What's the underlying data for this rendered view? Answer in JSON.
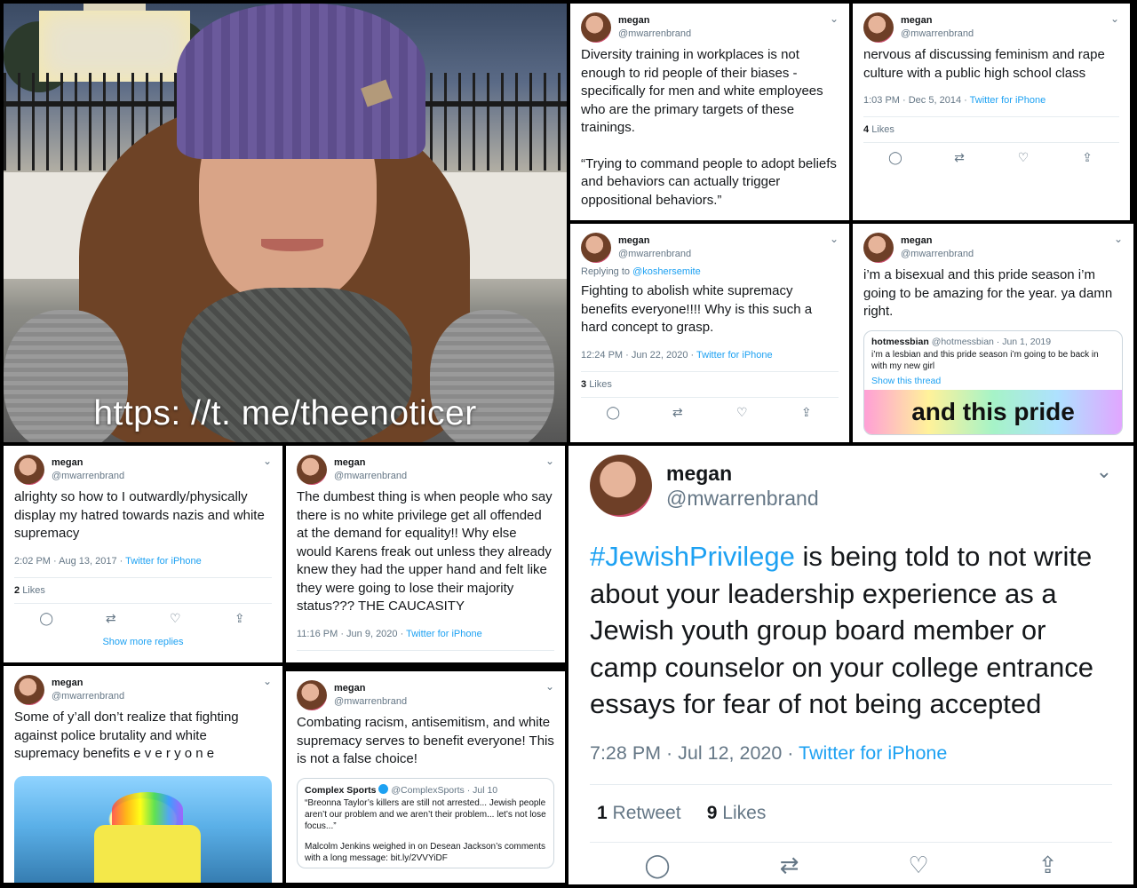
{
  "watermark": "https: //t. me/theenoticer",
  "user": {
    "name": "megan",
    "handle": "@mwarrenbrand"
  },
  "icons": {
    "chevron": "chevron-down-icon",
    "reply": "reply-icon",
    "retweet": "retweet-icon",
    "like": "heart-icon",
    "share": "share-icon"
  },
  "tweets": {
    "t1": {
      "text1": "Diversity training in workplaces is not enough to rid people of their biases - specifically for men and white employees who are the primary targets of these trainings.",
      "text2": "“Trying to command people to adopt beliefs and behaviors can actually trigger oppositional behaviors.”"
    },
    "t2": {
      "text": "nervous af discussing feminism and rape culture with a public high school class",
      "time": "1:03 PM · Dec 5, 2014",
      "source": "Twitter for iPhone",
      "likes_count": "4",
      "likes_label": "Likes"
    },
    "t3": {
      "replying_prefix": "Replying to",
      "replying_to": "@koshersemite",
      "text": "Fighting to abolish white supremacy benefits everyone!!!! Why is this such a hard concept to grasp.",
      "time": "12:24 PM · Jun 22, 2020",
      "source": "Twitter for iPhone",
      "likes_count": "3",
      "likes_label": "Likes"
    },
    "t4": {
      "text": "i’m a bisexual and this pride season i’m going to be amazing for the year. ya damn right.",
      "quote_name": "hotmessbian",
      "quote_meta": "@hotmessbian · Jun 1, 2019",
      "quote_text": "i’m a lesbian and this pride season i’m going to be back in with my new girl",
      "quote_link": "Show this thread",
      "quote_image_text": "and this pride"
    },
    "t5": {
      "text": "alrighty so how to I outwardly/physically display my hatred towards nazis and white supremacy",
      "time": "2:02 PM · Aug 13, 2017",
      "source": "Twitter for iPhone",
      "likes_count": "2",
      "likes_label": "Likes",
      "more_replies": "Show more replies"
    },
    "t6": {
      "text": "The dumbest thing is when people who say there is no white privilege get all offended at the demand for equality!! Why else would Karens freak out unless they already knew they had the upper hand and felt like they were going to lose their majority status??? THE CAUCASITY",
      "time": "11:16 PM · Jun 9, 2020",
      "source": "Twitter for iPhone"
    },
    "t7": {
      "text": "Some of y’all don’t realize that fighting against police brutality and white supremacy benefits e v e r y o n e"
    },
    "t8": {
      "text": "Combating racism, antisemitism, and white supremacy serves to benefit everyone! This is not a false choice!",
      "quote_name": "Complex Sports",
      "quote_meta": "@ComplexSports · Jul 10",
      "quote_text": "“Breonna Taylor’s killers are still not arrested... Jewish people aren’t our problem and we aren’t their problem... let’s not lose focus...”",
      "quote_text2": "Malcolm Jenkins weighed in on Desean Jackson’s comments with a long message: bit.ly/2VVYiDF"
    },
    "big": {
      "hashtag": "#JewishPrivilege",
      "text": " is being told to not write about your leadership experience as a Jewish youth group board member or camp counselor on your college entrance essays for fear of not being accepted",
      "time": "7:28 PM · Jul 12, 2020",
      "source": "Twitter for iPhone",
      "retweets_count": "1",
      "retweets_label": "Retweet",
      "likes_count": "9",
      "likes_label": "Likes"
    }
  },
  "action_glyphs": {
    "reply": "◯",
    "retweet": "⇄",
    "like": "♡",
    "share": "⇪",
    "chevron": "⌄",
    "sep": " · "
  }
}
